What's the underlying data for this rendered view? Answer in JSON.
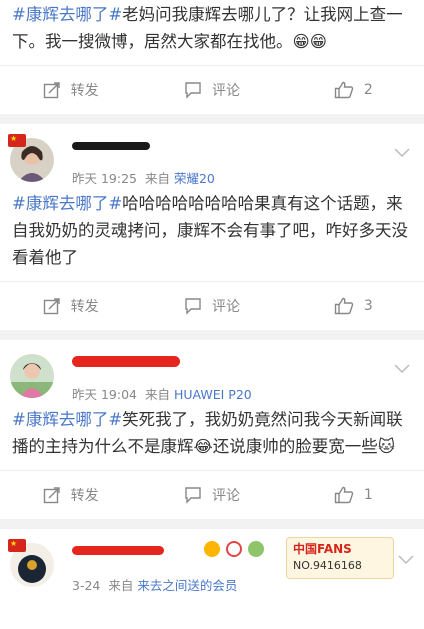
{
  "posts": [
    {
      "topic": "#康辉去哪了#",
      "text": "老妈问我康辉去哪儿了？让我网上查一下。我一搜微博，居然大家都在找他。😁😁",
      "actions": {
        "repost": "转发",
        "comment": "评论",
        "likes": "2"
      }
    },
    {
      "time": "昨天 19:25",
      "from": "来自",
      "source": "荣耀20",
      "topic": "#康辉去哪了#",
      "text": "哈哈哈哈哈哈哈哈果真有这个话题，来自我奶奶的灵魂拷问，康辉不会有事了吧，咋好多天没看着他了",
      "actions": {
        "repost": "转发",
        "comment": "评论",
        "likes": "3"
      }
    },
    {
      "time": "昨天 19:04",
      "from": "来自",
      "source": "HUAWEI P20",
      "topic": "#康辉去哪了#",
      "text": "笑死我了，我奶奶竟然问我今天新闻联播的主持为什么不是康辉😂还说康帅的脸要宽一些🐱",
      "actions": {
        "repost": "转发",
        "comment": "评论",
        "likes": "1"
      }
    },
    {
      "time": "3-24",
      "from": "来自",
      "source": "来去之间送的会员",
      "badge_title": "中国FANS",
      "badge_no": "NO.9416168"
    }
  ],
  "colors": {
    "link": "#4a78c8",
    "meta": "#888888",
    "flag": "#d6261c"
  }
}
